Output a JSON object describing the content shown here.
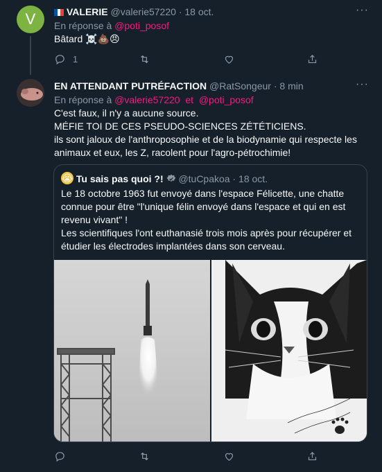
{
  "tweet1": {
    "avatar_letter": "V",
    "name": "VALERIE",
    "handle": "@valerie57220",
    "dot": "·",
    "date": "18 oct.",
    "reply_prefix": "En réponse à",
    "reply_to": "@poti_posof",
    "text": "Bâtard ☠️💩😠",
    "reply_count": "1",
    "more_label": "···"
  },
  "tweet2": {
    "name": "EN ATTENDANT PUTRÉFACTION",
    "handle": "@RatSongeur",
    "dot": "·",
    "date": "8 min",
    "reply_prefix": "En réponse à",
    "reply_to_1": "@valerie57220",
    "reply_and": "et",
    "reply_to_2": "@poti_posof",
    "lines": [
      "C'est faux, il n'y a aucune source.",
      "MÉFIE TOI DE CES PSEUDO-SCIENCES ZÉTÉTICIENS.",
      "ils sont jaloux de l'anthroposophie et de la biodynamie qui respecte les",
      "animaux et eux, les Z, racolent pour l'agro-pétrochimie!"
    ],
    "more_label": "···"
  },
  "quote": {
    "avatar_emoji": "😭",
    "name": "Tu sais pas quoi ?!",
    "handle": "@tuCpakoa",
    "dot": "·",
    "date": "18 oct.",
    "lines": [
      "Le 18 octobre 1963 fut envoyé dans l'espace Félicette, une chatte",
      "connue pour être \"l'unique félin envoyé dans l'espace et qui en est",
      "revenu vivant\" !",
      "Les scientifiques l'ont euthanasié trois mois après pour récupérer et",
      "étudier les électrodes implantées dans son cerveau."
    ]
  },
  "colors": {
    "background": "#15202b",
    "accent_link": "#f91880",
    "muted": "#8b98a5",
    "avatar_green": "#7cb342",
    "verified_gray": "#8b98a5"
  }
}
